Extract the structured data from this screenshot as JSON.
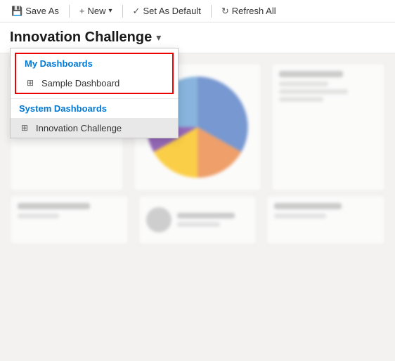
{
  "toolbar": {
    "save_as_label": "Save As",
    "new_label": "New",
    "set_as_default_label": "Set As Default",
    "refresh_all_label": "Refresh All"
  },
  "header": {
    "title": "Innovation Challenge",
    "chevron": "▾"
  },
  "dropdown": {
    "my_dashboards_label": "My Dashboards",
    "sample_dashboard_label": "Sample Dashboard",
    "system_dashboards_label": "System Dashboards",
    "innovation_challenge_label": "Innovation Challenge"
  },
  "icons": {
    "save": "💾",
    "new": "+",
    "check": "✓",
    "refresh": "↻",
    "grid": "⊞",
    "chevron_down": "▾",
    "dropdown_arrow": "▼"
  },
  "charts": {
    "pie": {
      "segments": [
        {
          "color": "#4472c4",
          "degrees": 130
        },
        {
          "color": "#ed7d31",
          "degrees": 90
        },
        {
          "color": "#ffc000",
          "degrees": 60
        },
        {
          "color": "#7030a0",
          "degrees": 45
        },
        {
          "color": "#5b9bd5",
          "degrees": 35
        }
      ]
    }
  }
}
